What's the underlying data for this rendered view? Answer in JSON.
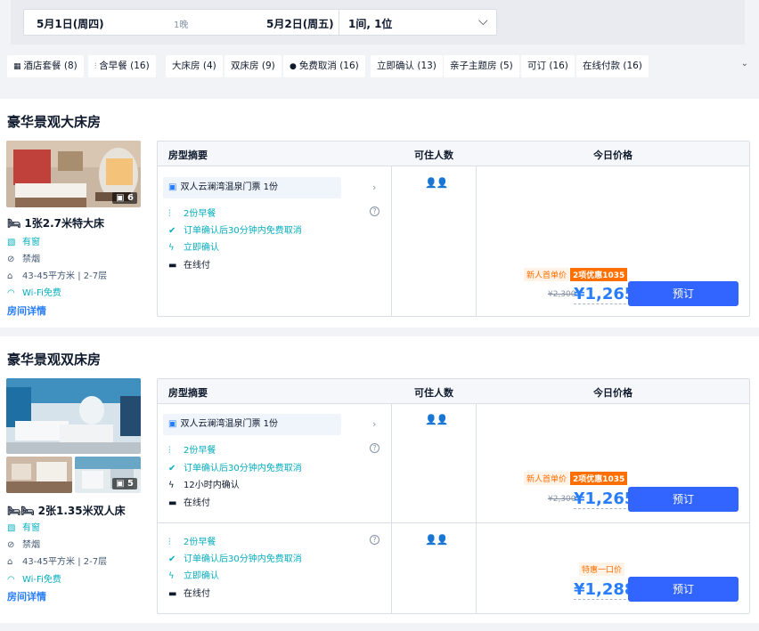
{
  "search": {
    "checkin": "5月1日(周四)",
    "nights": "1晚",
    "checkout": "5月2日(周五)",
    "guests": "1间, 1位"
  },
  "filters": [
    {
      "label": "酒店套餐",
      "count": "(8)",
      "icon": "grid-icon"
    },
    {
      "label": "含早餐",
      "count": "(16)",
      "icon": "utensils-icon"
    },
    {
      "label": "大床房",
      "count": "(4)"
    },
    {
      "label": "双床房",
      "count": "(9)"
    },
    {
      "label": "免费取消",
      "count": "(16)",
      "icon": "check-circle-icon"
    },
    {
      "label": "立即确认",
      "count": "(13)"
    },
    {
      "label": "亲子主题房",
      "count": "(5)"
    },
    {
      "label": "可订",
      "count": "(16)"
    },
    {
      "label": "在线付款",
      "count": "(16)"
    }
  ],
  "table_headers": {
    "summary": "房型摘要",
    "occupancy": "可住人数",
    "price": "今日价格"
  },
  "rooms": [
    {
      "title": "豪华景观大床房",
      "photo_count": "6",
      "bed": "1张2.7米特大床",
      "window": "有窗",
      "smoking": "禁烟",
      "area": "43-45平方米 | 2-7层",
      "wifi": "Wi-Fi免费",
      "details": "房间详情",
      "plans": [
        {
          "package": "双人云澜湾温泉门票 1份",
          "breakfast": "2份早餐",
          "cancel": "订单确认后30分钟内免费取消",
          "confirm": "立即确认",
          "payment": "在线付",
          "occupancy": "2",
          "promo_new": "新人首单价",
          "promo_disc": "2项优惠1035",
          "old_price": "¥2,300",
          "price": "¥1,265",
          "book": "预订"
        }
      ]
    },
    {
      "title": "豪华景观双床房",
      "photo_count": "5",
      "bed": "2张1.35米双人床",
      "window": "有窗",
      "smoking": "禁烟",
      "area": "43-45平方米 | 2-7层",
      "wifi": "Wi-Fi免费",
      "details": "房间详情",
      "plans": [
        {
          "package": "双人云澜湾温泉门票 1份",
          "breakfast": "2份早餐",
          "cancel": "订单确认后30分钟内免费取消",
          "confirm": "12小时内确认",
          "payment": "在线付",
          "occupancy": "2",
          "promo_new": "新人首单价",
          "promo_disc": "2项优惠1035",
          "old_price": "¥2,300",
          "price": "¥1,265",
          "book": "预订"
        },
        {
          "breakfast": "2份早餐",
          "cancel": "订单确认后30分钟内免费取消",
          "confirm": "立即确认",
          "payment": "在线付",
          "occupancy": "2",
          "promo_sale": "特惠一口价",
          "price": "¥1,288",
          "book": "预订"
        }
      ]
    }
  ],
  "colors": {
    "accent": "#287dfa",
    "button": "#3264ff",
    "promo": "#ff6f00",
    "green": "#06aebd"
  }
}
